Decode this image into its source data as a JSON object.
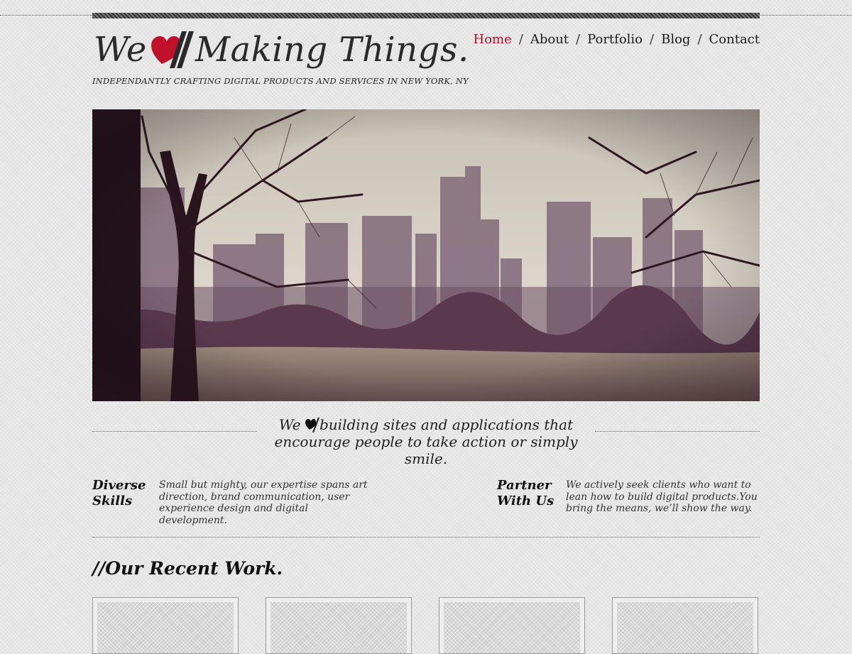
{
  "brand": {
    "logo_before": "We",
    "logo_after": "Making Things.",
    "tagline": "INDEPENDANTLY CRAFTING DIGITAL PRODUCTS AND SERVICES IN NEW YORK, NY",
    "accent_color": "#c0102a"
  },
  "nav": {
    "items": [
      {
        "label": "Home",
        "active": true
      },
      {
        "label": "About"
      },
      {
        "label": "Portfolio"
      },
      {
        "label": "Blog"
      },
      {
        "label": "Contact"
      }
    ],
    "separator": "/"
  },
  "hero": {
    "image": "central-park-skyline-photo"
  },
  "mission": {
    "line1_before": "We",
    "line1_after": "building sites and applications that",
    "line2": "encourage people to take action or simply smile."
  },
  "features": [
    {
      "title": "Diverse\nSkills",
      "text": "Small but mighty, our expertise spans art direction, brand communication, user experience design and digital development."
    },
    {
      "title": "Partner\nWith Us",
      "text": "We actively seek clients who want to lean how to build digital products.You bring the means, we’ll show the way."
    }
  ],
  "recent_work": {
    "title": "//Our Recent Work."
  }
}
